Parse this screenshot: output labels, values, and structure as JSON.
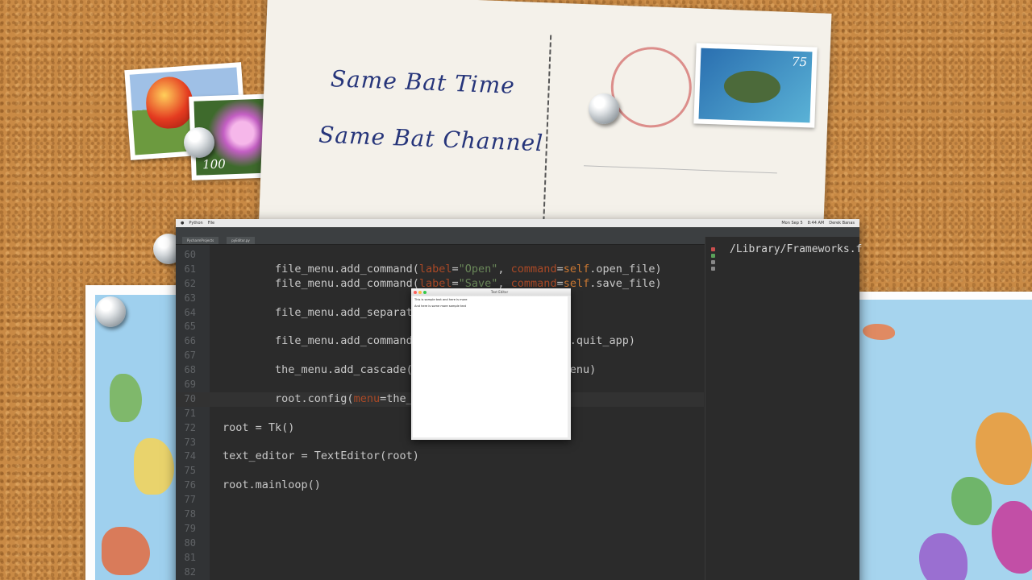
{
  "postcard": {
    "line1": "Same Bat Time",
    "line2": "Same Bat Channel",
    "stamp_values": [
      "75",
      "100"
    ]
  },
  "screen_menubar": {
    "left": [
      "Python",
      "File"
    ],
    "right": [
      "Mon Sep 5",
      "8:44 AM",
      "Derek Banas"
    ]
  },
  "ide": {
    "tabs": [
      "PycharmProjects",
      "pyEditor.py"
    ],
    "right_panel_text": "/Library/Frameworks.f",
    "code_lines": [
      {
        "num": "60",
        "text": ""
      },
      {
        "num": "61",
        "text": "        file_menu.add_command(label=\"Open\", command=self.open_file)"
      },
      {
        "num": "62",
        "text": "        file_menu.add_command(label=\"Save\", command=self.save_file)"
      },
      {
        "num": "63",
        "text": ""
      },
      {
        "num": "64",
        "text": "        file_menu.add_separat"
      },
      {
        "num": "65",
        "text": ""
      },
      {
        "num": "66",
        "text": "        file_menu.add_command                       f.quit_app)"
      },
      {
        "num": "67",
        "text": ""
      },
      {
        "num": "68",
        "text": "        the_menu.add_cascade(                        enu)"
      },
      {
        "num": "69",
        "text": ""
      },
      {
        "num": "70",
        "text": "        root.config(menu=the_m"
      },
      {
        "num": "71",
        "text": ""
      },
      {
        "num": "72",
        "text": "root = Tk()"
      },
      {
        "num": "73",
        "text": ""
      },
      {
        "num": "74",
        "text": "text_editor = TextEditor(root)"
      },
      {
        "num": "75",
        "text": ""
      },
      {
        "num": "76",
        "text": "root.mainloop()"
      },
      {
        "num": "77",
        "text": ""
      },
      {
        "num": "78",
        "text": ""
      },
      {
        "num": "79",
        "text": ""
      },
      {
        "num": "80",
        "text": ""
      },
      {
        "num": "81",
        "text": ""
      },
      {
        "num": "82",
        "text": ""
      }
    ]
  },
  "tk_window": {
    "title": "Text Editor",
    "text_line1": "This is sample text and here is more",
    "text_line2": "And here is some more sample text"
  },
  "colors": {
    "cork": "#c98a45",
    "ide_bg": "#2b2b2b",
    "keyword": "#cc7832",
    "string": "#6a8759",
    "param": "#aa4926"
  }
}
